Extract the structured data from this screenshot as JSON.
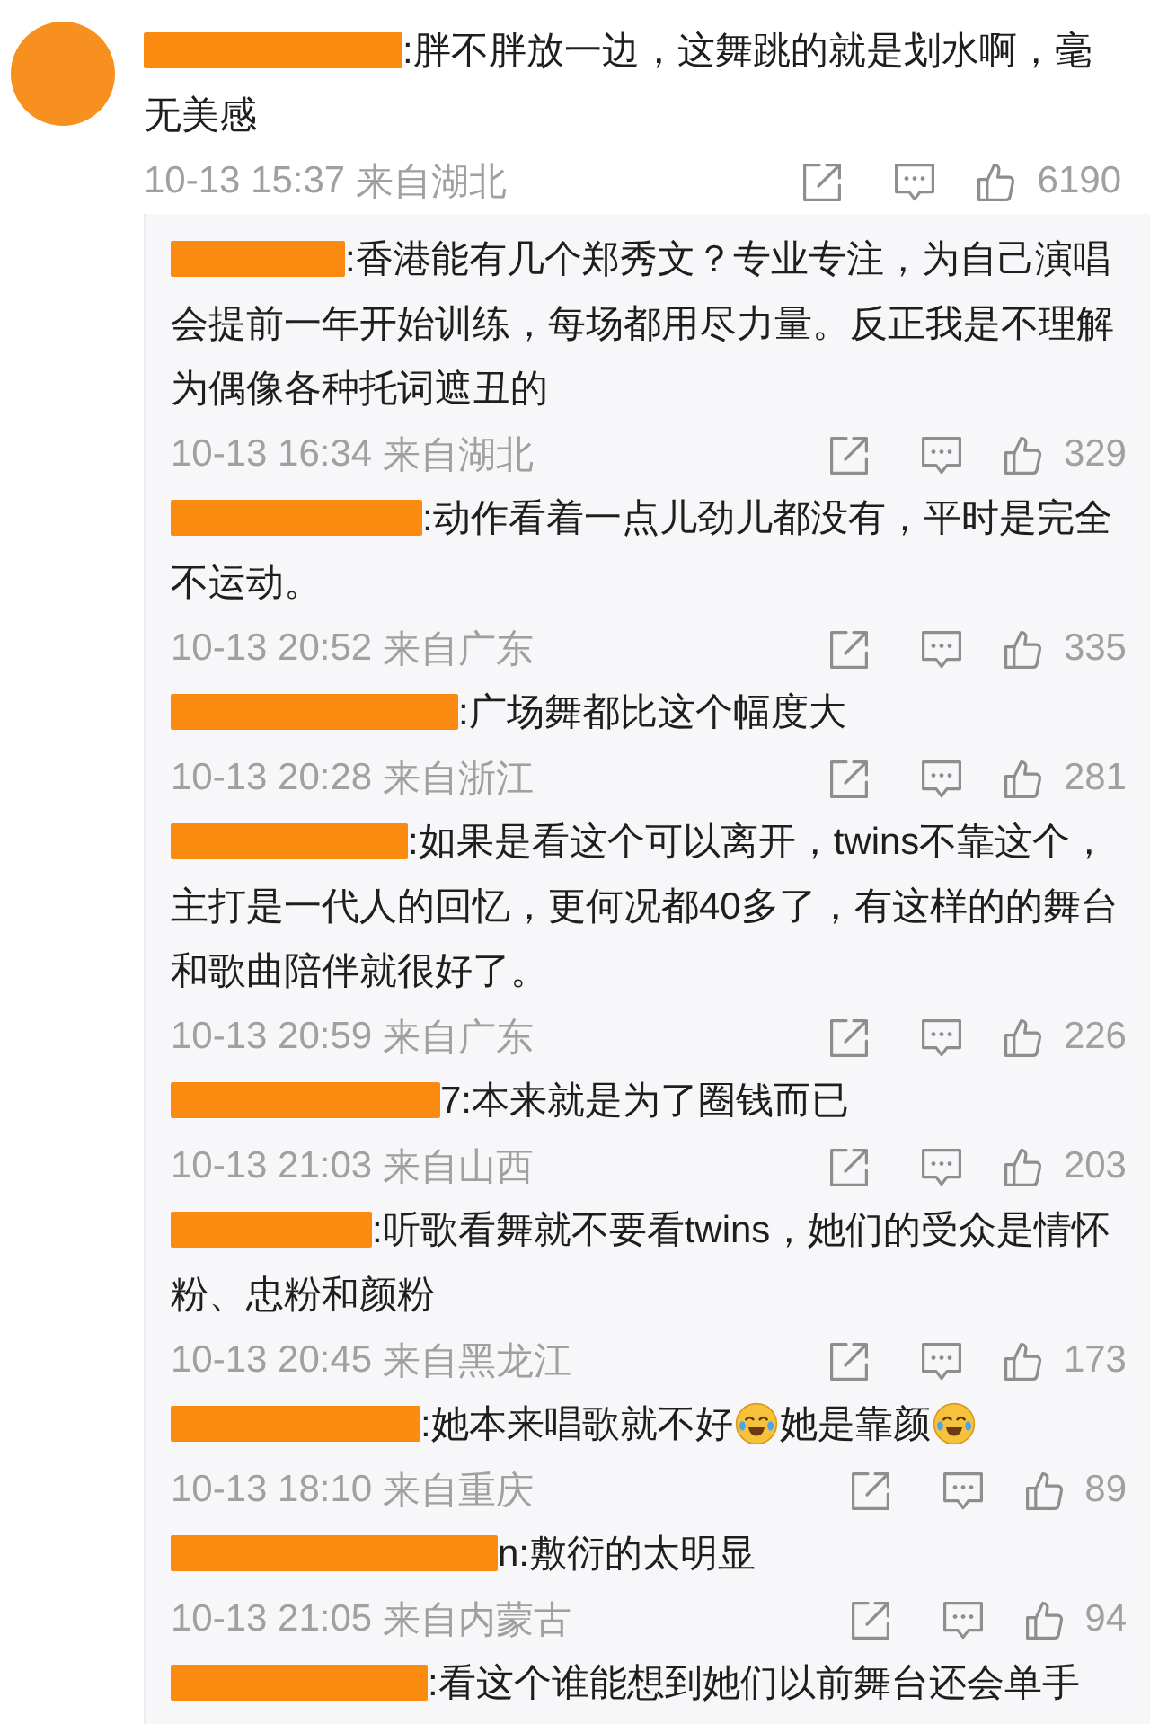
{
  "comment": {
    "author_redacted": true,
    "content": [
      {
        "kind": "text",
        "text": ":胖不胖放一边，这舞跳的就是划水啊，毫无美感"
      }
    ],
    "time": "10-13 15:37",
    "location": "来自湖北",
    "likes": "6190"
  },
  "replies": [
    {
      "author_redacted": true,
      "content": [
        {
          "kind": "text",
          "text": ":香港能有几个郑秀文？专业专注，为自己演唱会提前一年开始训练，每场都用尽力量。反正我是不理解为偶像各种托词遮丑的"
        }
      ],
      "time": "10-13 16:34",
      "location": "来自湖北",
      "likes": "329"
    },
    {
      "author_redacted": true,
      "content": [
        {
          "kind": "text",
          "text": ":动作看着一点儿劲儿都没有，平时是完全不运动。"
        }
      ],
      "time": "10-13 20:52",
      "location": "来自广东",
      "likes": "335"
    },
    {
      "author_redacted": true,
      "content": [
        {
          "kind": "text",
          "text": ":广场舞都比这个幅度大"
        }
      ],
      "time": "10-13 20:28",
      "location": "来自浙江",
      "likes": "281"
    },
    {
      "author_redacted": true,
      "content": [
        {
          "kind": "text",
          "text": ":如果是看这个可以离开，twins不靠这个，主打是一代人的回忆，更何况都40多了，有这样的的舞台和歌曲陪伴就很好了。"
        }
      ],
      "time": "10-13 20:59",
      "location": "来自广东",
      "likes": "226"
    },
    {
      "author_redacted": true,
      "content": [
        {
          "kind": "text",
          "text": "7:本来就是为了圈钱而已"
        }
      ],
      "time": "10-13 21:03",
      "location": "来自山西",
      "likes": "203"
    },
    {
      "author_redacted": true,
      "content": [
        {
          "kind": "text",
          "text": ":听歌看舞就不要看twins，她们的受众是情怀粉、忠粉和颜粉"
        }
      ],
      "time": "10-13 20:45",
      "location": "来自黑龙江",
      "likes": "173"
    },
    {
      "author_redacted": true,
      "content": [
        {
          "kind": "text",
          "text": ":她本来唱歌就不好"
        },
        {
          "kind": "emoji"
        },
        {
          "kind": "text",
          "text": "她是靠颜"
        },
        {
          "kind": "emoji"
        }
      ],
      "time": "10-13 18:10",
      "location": "来自重庆",
      "likes": "89"
    },
    {
      "author_redacted": true,
      "content": [
        {
          "kind": "text",
          "text": "n:敷衍的太明显"
        }
      ],
      "time": "10-13 21:05",
      "location": "来自内蒙古",
      "likes": "94"
    },
    {
      "author_redacted": true,
      "content": [
        {
          "kind": "text",
          "text": ":看这个谁能想到她们以前舞台还会单手"
        }
      ]
    }
  ]
}
